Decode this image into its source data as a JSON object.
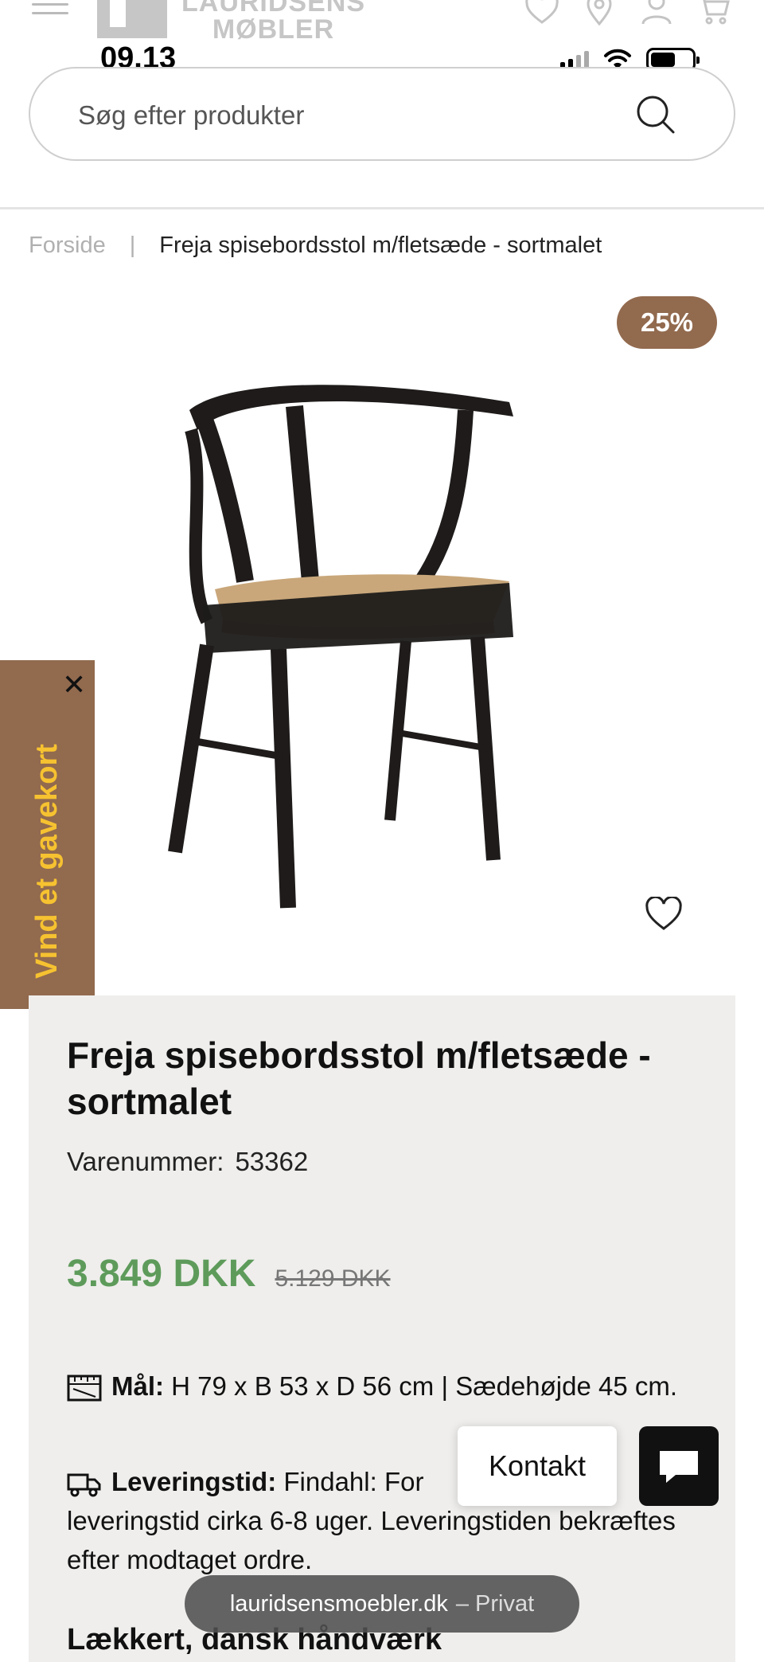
{
  "status_bar": {
    "time": "09.13"
  },
  "header": {
    "logo_text_line1": "LAURIDSENS",
    "logo_text_line2": "MØBLER",
    "icons": [
      "heart-icon",
      "location-icon",
      "user-icon",
      "cart-icon"
    ]
  },
  "search": {
    "placeholder": "Søg efter produkter"
  },
  "breadcrumb": {
    "home": "Forside",
    "separator": "|",
    "current": "Freja spisebordsstol m/fletsæde - sortmalet"
  },
  "badge": {
    "discount": "25%"
  },
  "side_tab": {
    "label": "Vind et gavekort",
    "close": "✕"
  },
  "product": {
    "title": "Freja spisebordsstol m/fletsæde - sortmalet",
    "sku_label": "Varenummer:",
    "sku_value": "53362",
    "price": "3.849 DKK",
    "old_price": "5.129 DKK",
    "dimensions_label": "Mål:",
    "dimensions_value": "H 79 x B 53 x D 56 cm | Sædehøjde 45 cm.",
    "delivery_label": "Leveringstid:",
    "delivery_value": "Findahl: For",
    "delivery_value_rest": "leveringstid cirka 6-8 uger. Leveringstiden bekræftes efter modtaget ordre.",
    "subheading": "Lækkert, dansk håndværk"
  },
  "contact": {
    "label": "Kontakt"
  },
  "browser": {
    "url": "lauridsensmoebler.dk",
    "mode": "– Privat"
  },
  "colors": {
    "accent_brown": "#926a4e",
    "price_green": "#5e9b5b",
    "tab_text_yellow": "#f6c230"
  }
}
